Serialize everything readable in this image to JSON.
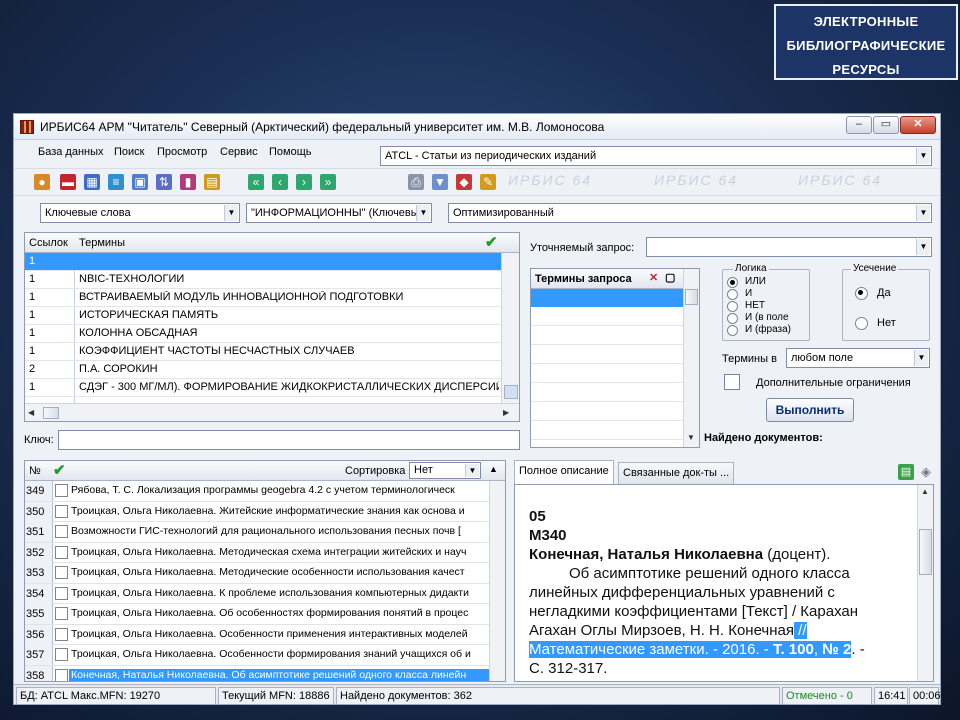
{
  "slide_title": [
    "ЭЛЕКТРОННЫЕ",
    "БИБЛИОГРАФИЧЕСКИЕ",
    "РЕСУРСЫ"
  ],
  "window": {
    "title": "ИРБИС64   АРМ \"Читатель\"   Северный (Арктический) федеральный университет им. М.В. Ломоносова",
    "controls": {
      "minimize": "–",
      "maximize": "▭",
      "close": "✕"
    }
  },
  "menu": [
    "База данных",
    "Поиск",
    "Просмотр",
    "Сервис",
    "Помощь"
  ],
  "database_select": "ATCL - Статьи из периодических изданий",
  "search": {
    "index_select": "Ключевые слова",
    "term_select": "\"ИНФОРМАЦИОННЫ\" (Ключевы",
    "mode_select": "Оптимизированный"
  },
  "toolbar_watermark": [
    "ИРБИС 64",
    "ИРБИС 64",
    "ИРБИС 64"
  ],
  "terms_grid": {
    "columns": [
      "Ссылок",
      "Термины"
    ],
    "rows": [
      {
        "count": "1",
        "term": ""
      },
      {
        "count": "1",
        "term": "NBIC-ТЕХНОЛОГИИ"
      },
      {
        "count": "1",
        "term": "ВСТРАИВАЕМЫЙ МОДУЛЬ ИННОВАЦИОННОЙ ПОДГОТОВКИ"
      },
      {
        "count": "1",
        "term": "ИСТОРИЧЕСКАЯ ПАМЯТЬ"
      },
      {
        "count": "1",
        "term": "КОЛОННА ОБСАДНАЯ"
      },
      {
        "count": "1",
        "term": "КОЭФФИЦИЕНТ ЧАСТОТЫ НЕСЧАСТНЫХ СЛУЧАЕВ"
      },
      {
        "count": "2",
        "term": "П.А. СОРОКИН"
      },
      {
        "count": "1",
        "term": "СДЭГ - 300 МГ/МЛ). ФОРМИРОВАНИЕ ЖИДКОКРИСТАЛЛИЧЕСКИХ ДИСПЕРСИЙ"
      }
    ],
    "key_label": "Ключ:",
    "key_value": ""
  },
  "query": {
    "refine_label": "Уточняемый запрос:",
    "refine_value": "",
    "terms_header": "Термины запроса",
    "logic_legend": "Логика",
    "logic_options": [
      "ИЛИ",
      "И",
      "НЕТ",
      "И (в поле",
      "И (фраза)"
    ],
    "logic_selected": 0,
    "truncation_legend": "Усечение",
    "truncation_options": [
      "Да",
      "Нет"
    ],
    "truncation_selected": 0,
    "terms_in_label": "Термины в",
    "terms_in_value": "любом поле",
    "extra_limits_label": "Дополнительные ограничения",
    "run_button": "Выполнить",
    "found_label": "Найдено документов:"
  },
  "records": {
    "header_num": "№",
    "sort_label": "Сортировка",
    "sort_value": "Нет",
    "rows": [
      {
        "num": "349",
        "text": "Рябова, Т. С. Локализация программы geogebra 4.2 с учетом терминологическ",
        "selected": false
      },
      {
        "num": "350",
        "text": "Троицкая, Ольга Николаевна. Житейские информатические знания как основа и",
        "selected": false
      },
      {
        "num": "351",
        "text": "Возможности ГИС-технологий для рационального использования песных почв [",
        "selected": false
      },
      {
        "num": "352",
        "text": "Троицкая, Ольга Николаевна. Методическая схема интеграции житейских и науч",
        "selected": false
      },
      {
        "num": "353",
        "text": "Троицкая, Ольга Николаевна. Методические особенности использования качест",
        "selected": false
      },
      {
        "num": "354",
        "text": "Троицкая, Ольга Николаевна. К проблеме использования компьютерных дидакти",
        "selected": false
      },
      {
        "num": "355",
        "text": "Троицкая, Ольга Николаевна. Об особенностях формирования понятий в процес",
        "selected": false
      },
      {
        "num": "356",
        "text": "Троицкая, Ольга Николаевна. Особенности применения интерактивных моделей",
        "selected": false
      },
      {
        "num": "357",
        "text": "Троицкая, Ольга Николаевна. Особенности формирования знаний учащихся об и",
        "selected": false
      },
      {
        "num": "358",
        "text": "Конечная, Наталья Николаевна. Об асимптотике решений одного класса линейн",
        "selected": true
      }
    ]
  },
  "description": {
    "tabs": [
      "Полное описание",
      "Связанные док-ты ..."
    ],
    "line1": "05",
    "line2": "М340",
    "author": "Конечная, Наталья Николаевна",
    "author_role": " (доцент).",
    "body": [
      "Об асимптотике решений одного класса",
      "линейных дифференциальных уравнений с",
      "негладкими коэффициентами [Текст] / Карахан",
      "Агахан Оглы Мирзоев, Н. Н. Конечная"
    ],
    "body_sep": " //",
    "source": "Математические заметки. - 2016. - ",
    "volume": "Т. 100",
    "issue_sep": ", ",
    "issue": "№ 2",
    "issue_tail": ". -",
    "pages": "С. 312-317."
  },
  "status": {
    "db": "БД: ATCL Макс.MFN: 19270",
    "current": "Текущий MFN: 18886",
    "found": "Найдено документов: 362",
    "marked": "Отмечено - 0",
    "clock": "16:41",
    "elapsed": "00:06"
  },
  "colors": {
    "selection": "#3399ff",
    "slide_box": "#1c3566",
    "marked_text": "#1e8a1e"
  }
}
